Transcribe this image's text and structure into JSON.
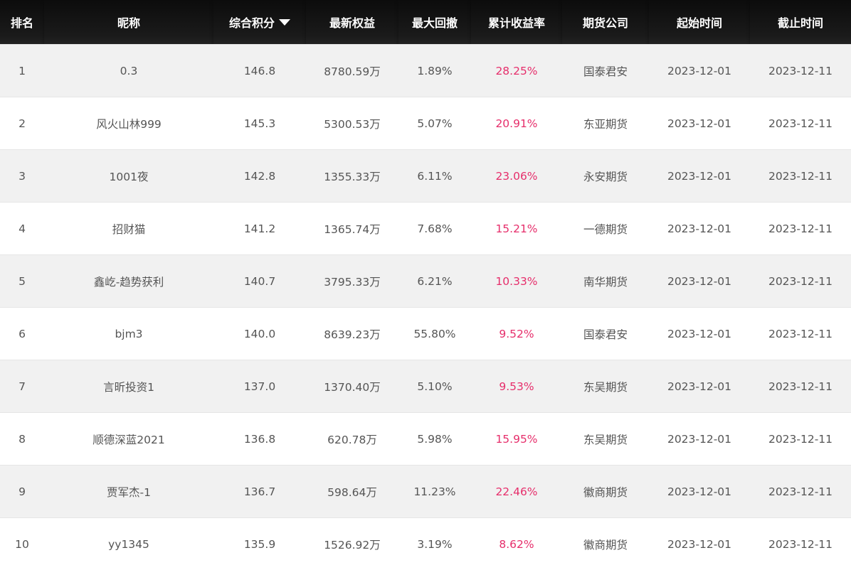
{
  "columns": {
    "rank": "排名",
    "nickname": "昵称",
    "score": "综合积分",
    "equity": "最新权益",
    "drawdown": "最大回撤",
    "return": "累计收益率",
    "broker": "期货公司",
    "start": "起始时间",
    "end": "截止时间"
  },
  "sort": {
    "column": "score",
    "direction": "desc",
    "icon": "caret-down-icon"
  },
  "colors": {
    "header_bg": "#111111",
    "return_text": "#e62e6b",
    "stripe": "#f1f1f1"
  },
  "rows": [
    {
      "rank": "1",
      "nickname": "0.3",
      "score": "146.8",
      "equity": "8780.59万",
      "drawdown": "1.89%",
      "return": "28.25%",
      "broker": "国泰君安",
      "start": "2023-12-01",
      "end": "2023-12-11"
    },
    {
      "rank": "2",
      "nickname": "风火山林999",
      "score": "145.3",
      "equity": "5300.53万",
      "drawdown": "5.07%",
      "return": "20.91%",
      "broker": "东亚期货",
      "start": "2023-12-01",
      "end": "2023-12-11"
    },
    {
      "rank": "3",
      "nickname": "1001夜",
      "score": "142.8",
      "equity": "1355.33万",
      "drawdown": "6.11%",
      "return": "23.06%",
      "broker": "永安期货",
      "start": "2023-12-01",
      "end": "2023-12-11"
    },
    {
      "rank": "4",
      "nickname": "招财猫",
      "score": "141.2",
      "equity": "1365.74万",
      "drawdown": "7.68%",
      "return": "15.21%",
      "broker": "一德期货",
      "start": "2023-12-01",
      "end": "2023-12-11"
    },
    {
      "rank": "5",
      "nickname": "鑫屹-趋势获利",
      "score": "140.7",
      "equity": "3795.33万",
      "drawdown": "6.21%",
      "return": "10.33%",
      "broker": "南华期货",
      "start": "2023-12-01",
      "end": "2023-12-11"
    },
    {
      "rank": "6",
      "nickname": "bjm3",
      "score": "140.0",
      "equity": "8639.23万",
      "drawdown": "55.80%",
      "return": "9.52%",
      "broker": "国泰君安",
      "start": "2023-12-01",
      "end": "2023-12-11"
    },
    {
      "rank": "7",
      "nickname": "言昕投资1",
      "score": "137.0",
      "equity": "1370.40万",
      "drawdown": "5.10%",
      "return": "9.53%",
      "broker": "东吴期货",
      "start": "2023-12-01",
      "end": "2023-12-11"
    },
    {
      "rank": "8",
      "nickname": "顺德深蓝2021",
      "score": "136.8",
      "equity": "620.78万",
      "drawdown": "5.98%",
      "return": "15.95%",
      "broker": "东吴期货",
      "start": "2023-12-01",
      "end": "2023-12-11"
    },
    {
      "rank": "9",
      "nickname": "贾军杰-1",
      "score": "136.7",
      "equity": "598.64万",
      "drawdown": "11.23%",
      "return": "22.46%",
      "broker": "徽商期货",
      "start": "2023-12-01",
      "end": "2023-12-11"
    },
    {
      "rank": "10",
      "nickname": "yy1345",
      "score": "135.9",
      "equity": "1526.92万",
      "drawdown": "3.19%",
      "return": "8.62%",
      "broker": "徽商期货",
      "start": "2023-12-01",
      "end": "2023-12-11"
    }
  ]
}
